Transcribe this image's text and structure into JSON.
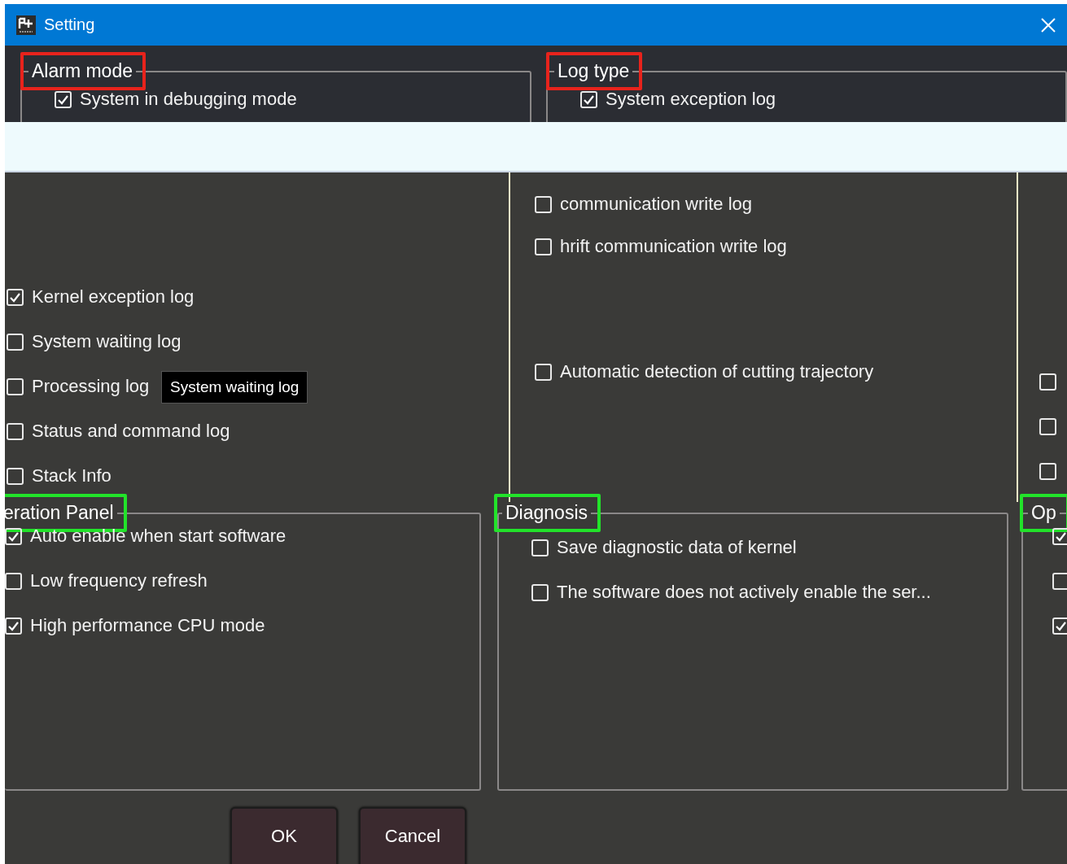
{
  "window": {
    "title": "Setting"
  },
  "top_groups": [
    {
      "title": "Alarm mode",
      "color": "#e8231c",
      "items": [
        {
          "label": "System in debugging mode",
          "checked": true
        }
      ]
    },
    {
      "title": "Log type",
      "color": "#e8231c",
      "items": [
        {
          "label": "System exception log",
          "checked": true
        }
      ]
    }
  ],
  "left_items": [
    {
      "label": "Kernel exception log",
      "checked": true
    },
    {
      "label": "System waiting log",
      "checked": false
    },
    {
      "label": "Processing log",
      "checked": false
    },
    {
      "label": "Status and command log",
      "checked": false
    },
    {
      "label": "Stack Info",
      "checked": false
    }
  ],
  "tooltip": "System waiting log",
  "middle_items": [
    {
      "label": "communication write log",
      "checked": false
    },
    {
      "label": "hrift communication write log",
      "checked": false
    },
    {
      "label": "Automatic detection of cutting trajectory",
      "checked": false
    }
  ],
  "right_items": [
    {
      "checked": false
    },
    {
      "checked": false
    },
    {
      "checked": false
    }
  ],
  "bottom_groups": [
    {
      "title": "eration Panel",
      "color": "#22e32a",
      "items": [
        {
          "label": "Auto enable when start software",
          "checked": true
        },
        {
          "label": "Low frequency refresh",
          "checked": false
        },
        {
          "label": "High performance CPU mode",
          "checked": true
        }
      ]
    },
    {
      "title": "Diagnosis",
      "color": "#22e32a",
      "items": [
        {
          "label": "Save diagnostic data of kernel",
          "checked": false
        },
        {
          "label": "The software does not actively enable the ser...",
          "checked": false
        }
      ]
    },
    {
      "title": "Op",
      "color": "#22e32a",
      "items": [
        {
          "checked": true
        },
        {
          "checked": false
        },
        {
          "checked": true
        }
      ]
    }
  ],
  "buttons": [
    "OK",
    "Cancel"
  ]
}
